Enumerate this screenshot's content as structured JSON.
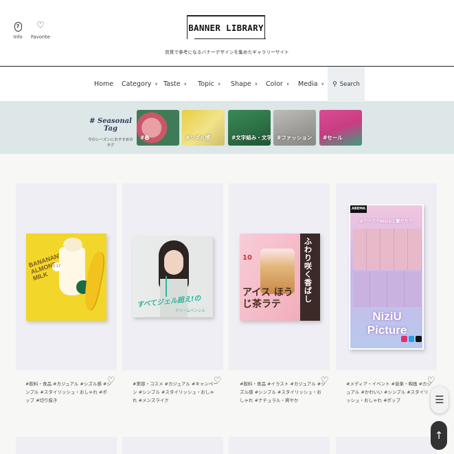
{
  "header": {
    "info_label": "Info",
    "favorite_label": "Favorite",
    "logo_text": "BANNER LIBRARY",
    "tagline": "良質で参考になるバナーデザインを集めたギャラリーサイト"
  },
  "nav": {
    "items": [
      {
        "label": "Home",
        "has_dropdown": false
      },
      {
        "label": "Category",
        "has_dropdown": true
      },
      {
        "label": "Taste",
        "has_dropdown": true
      },
      {
        "label": "Topic",
        "has_dropdown": true
      },
      {
        "label": "Shape",
        "has_dropdown": true
      },
      {
        "label": "Color",
        "has_dropdown": true
      },
      {
        "label": "Media",
        "has_dropdown": true
      }
    ],
    "search_label": "Search"
  },
  "seasonal": {
    "title": "# Seasonal Tag",
    "subtitle": "今のシーズンにおすすめのタグ",
    "tags": [
      {
        "label": "#春",
        "color": "#c9576a"
      },
      {
        "label": "#シズル感",
        "color": "#e2c63c"
      },
      {
        "label": "#文字組み・文字だけ",
        "color": "#2f7a4a"
      },
      {
        "label": "#ファッション",
        "color": "#a9a7a4"
      },
      {
        "label": "#セール",
        "color": "#d1458c"
      }
    ]
  },
  "cards": [
    {
      "tags": "#飲料・食品 #カジュアル #シズル感 #シンプル #スタイリッシュ・おしゃれ #ポップ #切り抜き",
      "banner_text": "BANANAN' ALMOND MILK",
      "banner_date": "3 17",
      "accent": "#f3d62a"
    },
    {
      "tags": "#美容・コスメ #カジュアル #キャンペーン #シンプル #スタイリッシュ・おしゃれ #メンズライク",
      "banner_text": "すべてジェル超え!の",
      "banner_sub": "クリームペンシル",
      "accent": "#2fb5a0"
    },
    {
      "tags": "#飲料・食品 #イラスト #カジュアル #シズル感 #シンプル #スタイリッシュ・おしゃれ #ナチュラル・爽やか",
      "banner_text": "アイス ほうじ茶ラテ",
      "banner_vertical": "ふわり咲く 香ばし",
      "banner_number": "10",
      "accent": "#f0a7b8"
    },
    {
      "tags": "#メディア・イベント #音楽・映画 #カジュアル #かわいい #シンプル #スタイリッシュ・おしゃれ #ポップ",
      "banner_logo": "ABEMA",
      "banner_top": "#アベマでNiziUと繋がろう",
      "banner_text": "NiziU Picture",
      "accent": "#c9b8e8"
    }
  ]
}
